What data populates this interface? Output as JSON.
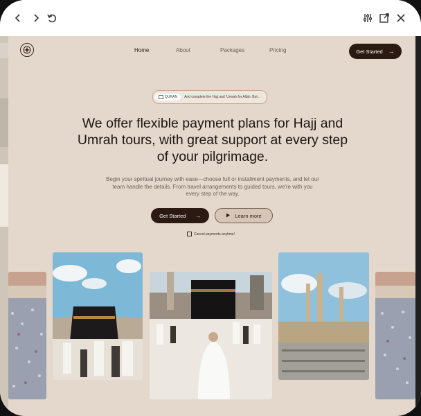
{
  "browser": {
    "back_icon": "chevron-left-icon",
    "forward_icon": "chevron-right-icon",
    "reload_icon": "reload-icon",
    "settings_icon": "sliders-icon",
    "open_external_icon": "external-link-icon",
    "close_icon": "close-icon"
  },
  "nav": {
    "home": "Home",
    "about": "About",
    "packages": "Packages",
    "pricing": "Pricing",
    "cta": "Get Started"
  },
  "hero": {
    "badge_tag": "QURAN",
    "badge_text": "And complete the Hajj and 'Umrah for Allah. But...",
    "title": "We offer flexible payment plans for Hajj and Umrah tours, with great support at every step of your pilgrimage.",
    "subtitle": "Begin your spiritual journey with ease—choose full or installment payments, and let our team handle the details. From travel arrangements to guided tours, we're with you every step of the way.",
    "primary_button": "Get Started",
    "secondary_button": "Learn more",
    "cancel_note": "Cancel payments anytime!"
  },
  "colors": {
    "page_bg": "#e3d8cb",
    "dark_brand": "#2a1a12",
    "badge_border": "#c8a58e"
  },
  "gallery": {
    "images": [
      "crowd-photo",
      "kaaba-sky-photo",
      "kaaba-pilgrim-photo",
      "mosque-minarets-photo",
      "crowd-photo"
    ]
  }
}
